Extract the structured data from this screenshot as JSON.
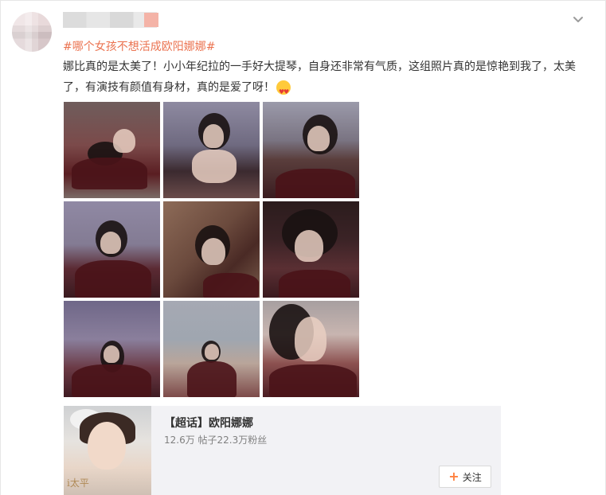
{
  "post": {
    "hashtag": "#哪个女孩不想活成欧阳娜娜#",
    "text": "娜比真的是太美了！小小年纪拉的一手好大提琴，自身还非常有气质，这组照片真的是惊艳到我了，太美了，有演技有颜值有身材，真的是爱了呀！",
    "emoji_icon": "heart-eyes-emoji-icon"
  },
  "photos": [
    {
      "icon": "photo-1"
    },
    {
      "icon": "photo-2"
    },
    {
      "icon": "photo-3"
    },
    {
      "icon": "photo-4"
    },
    {
      "icon": "photo-5"
    },
    {
      "icon": "photo-6"
    },
    {
      "icon": "photo-7"
    },
    {
      "icon": "photo-8"
    },
    {
      "icon": "photo-9"
    }
  ],
  "supertopic": {
    "title": "【超话】欧阳娜娜",
    "stats": "12.6万 帖子22.3万粉丝",
    "follow_label": "关注",
    "cover_mark": "i太平"
  },
  "colors": {
    "hashtag": "#eb7350",
    "follow_plus": "#ff8140",
    "card_bg": "#f2f2f5"
  }
}
